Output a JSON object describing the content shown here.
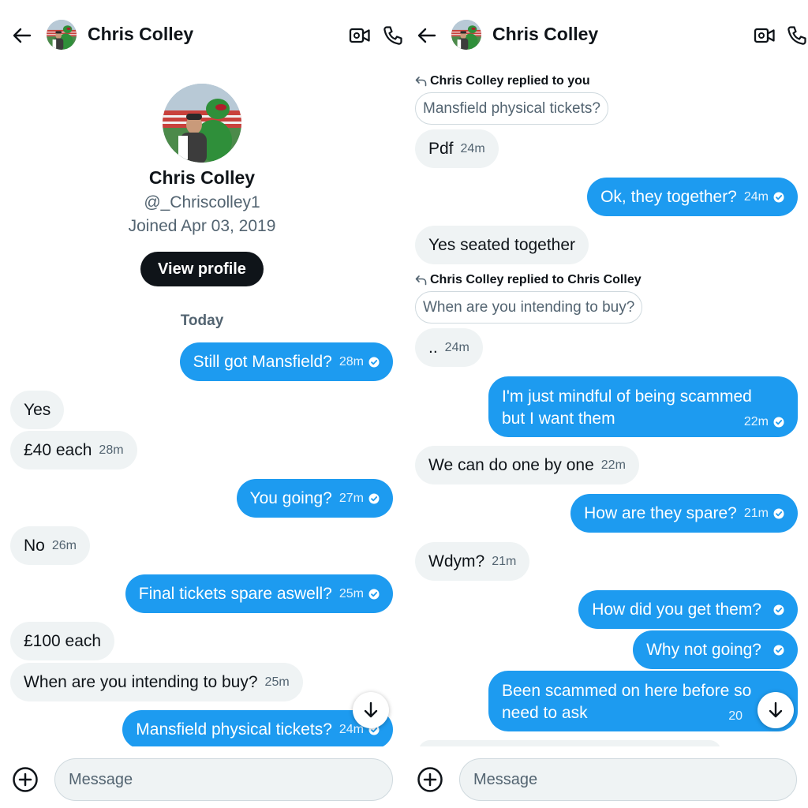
{
  "colors": {
    "accent": "#1d9bf0",
    "incoming_bg": "#eff3f4",
    "text": "#0f1419",
    "secondary": "#536471",
    "button_dark": "#0f1419"
  },
  "icons": {
    "back": "arrow-left-icon",
    "video": "video-call-icon",
    "phone": "phone-icon",
    "add": "plus-circle-icon",
    "scroll": "arrow-down-icon",
    "check": "check-circle-icon",
    "reply": "reply-arrow-icon"
  },
  "left": {
    "header": {
      "name": "Chris Colley"
    },
    "profile": {
      "name": "Chris Colley",
      "handle": "@_Chriscolley1",
      "joined": "Joined Apr 03, 2019",
      "view_profile": "View profile"
    },
    "day_separator": "Today",
    "messages": [
      {
        "text": "Still got Mansfield?",
        "time": "28m",
        "direction": "out"
      },
      {
        "text": "Yes",
        "time": "",
        "direction": "in"
      },
      {
        "text": "£40 each",
        "time": "28m",
        "direction": "in"
      },
      {
        "text": "You going?",
        "time": "27m",
        "direction": "out"
      },
      {
        "text": "No",
        "time": "26m",
        "direction": "in"
      },
      {
        "text": "Final tickets spare aswell?",
        "time": "25m",
        "direction": "out"
      },
      {
        "text": "£100 each",
        "time": "",
        "direction": "in"
      },
      {
        "text": "When are you intending to buy?",
        "time": "25m",
        "direction": "in"
      },
      {
        "text": "Mansfield physical tickets?",
        "time": "24m",
        "direction": "out"
      }
    ],
    "composer": {
      "placeholder": "Message"
    }
  },
  "right": {
    "header": {
      "name": "Chris Colley"
    },
    "reply1": {
      "label": "Chris Colley replied to you",
      "quoted": "Mansfield physical tickets?"
    },
    "reply2": {
      "label": "Chris Colley replied to Chris Colley",
      "quoted": "When are you intending to buy?"
    },
    "messages": [
      {
        "text": "Pdf",
        "time": "24m",
        "direction": "in"
      },
      {
        "text": "Ok, they together?",
        "time": "24m",
        "direction": "out"
      },
      {
        "text": "Yes seated together",
        "time": "",
        "direction": "in"
      },
      {
        "text": "..",
        "time": "24m",
        "direction": "in"
      },
      {
        "line1": "I'm just mindful of being scammed",
        "line2": "but I want them",
        "time": "22m",
        "direction": "out"
      },
      {
        "text": "We can do one by one",
        "time": "22m",
        "direction": "in"
      },
      {
        "text": "How are they spare?",
        "time": "21m",
        "direction": "out"
      },
      {
        "text": "Wdym?",
        "time": "21m",
        "direction": "in"
      },
      {
        "text": "How did you get them?",
        "time": "",
        "direction": "out"
      },
      {
        "text": "Why not going?",
        "time": "",
        "direction": "out"
      },
      {
        "line1": "Been scammed on here before so",
        "line2": "need to ask",
        "time": "20",
        "direction": "out"
      }
    ],
    "composer": {
      "placeholder": "Message"
    }
  }
}
